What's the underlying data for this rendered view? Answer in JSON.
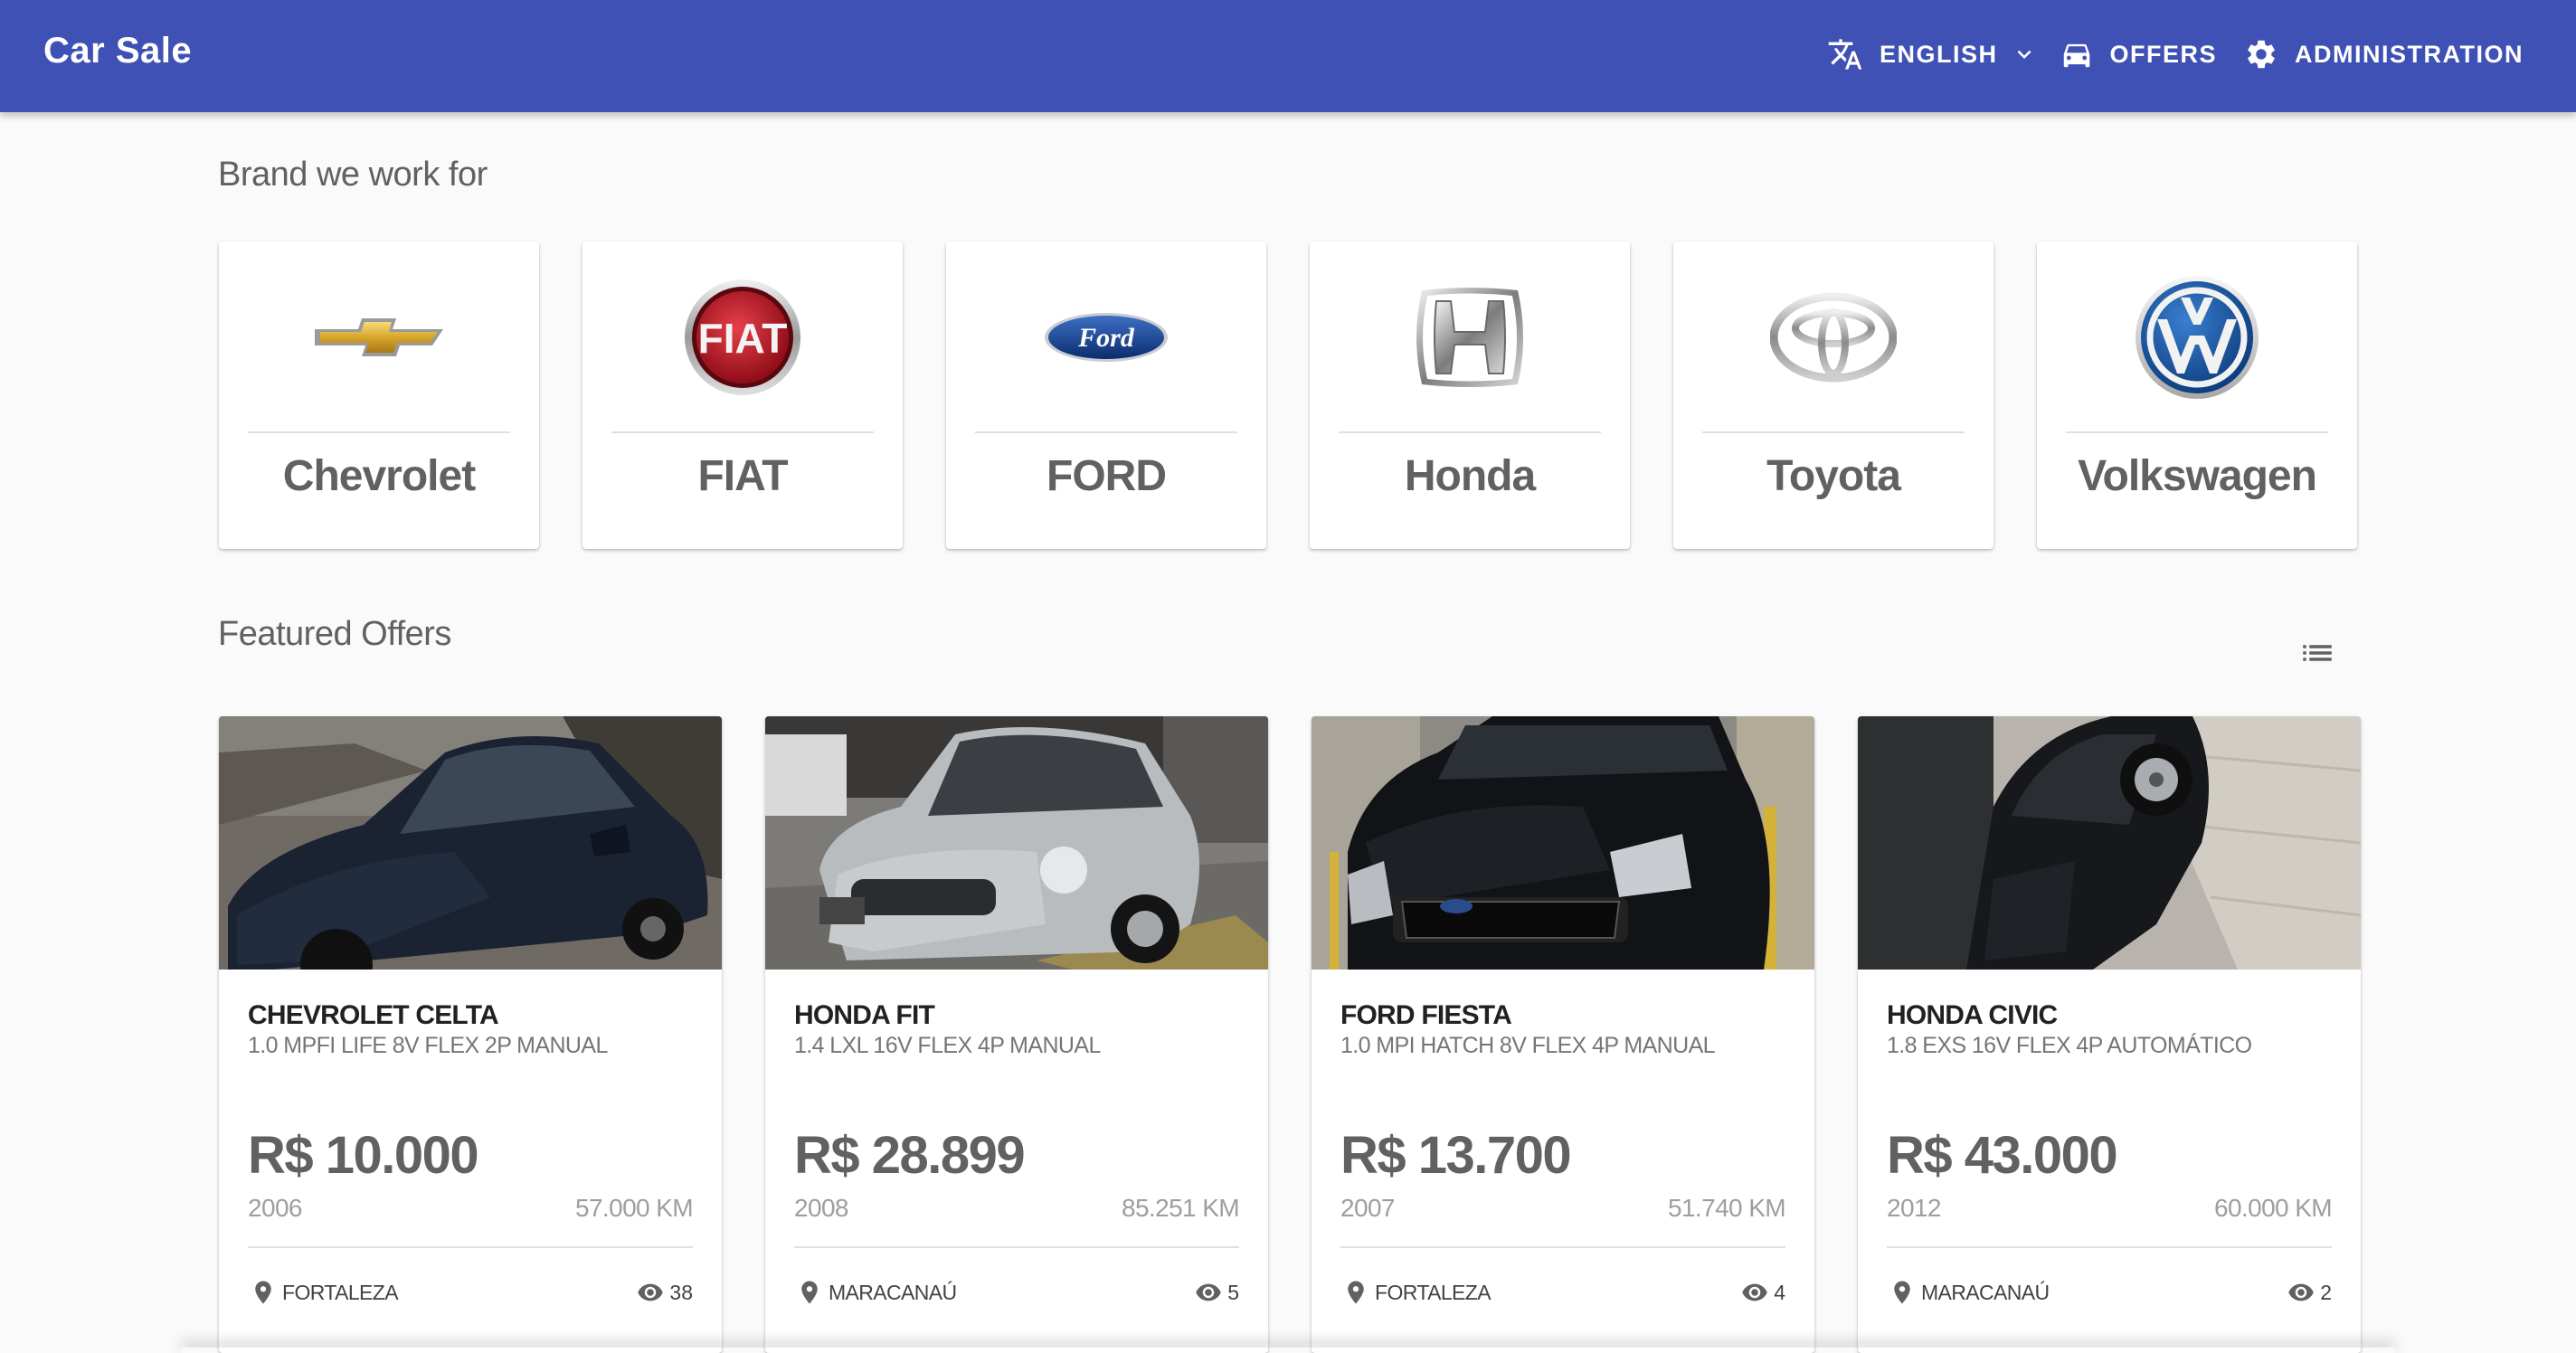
{
  "app": {
    "title": "Car Sale"
  },
  "nav": {
    "language_label": "ENGLISH",
    "offers_label": "OFFERS",
    "administration_label": "ADMINISTRATION"
  },
  "brands_section": {
    "title": "Brand we work for",
    "brands": [
      {
        "name": "Chevrolet",
        "logo_icon": "chevrolet-bowtie-logo"
      },
      {
        "name": "FIAT",
        "logo_icon": "fiat-logo"
      },
      {
        "name": "FORD",
        "logo_icon": "ford-oval-logo"
      },
      {
        "name": "Honda",
        "logo_icon": "honda-h-logo"
      },
      {
        "name": "Toyota",
        "logo_icon": "toyota-logo"
      },
      {
        "name": "Volkswagen",
        "logo_icon": "volkswagen-logo"
      }
    ]
  },
  "featured_section": {
    "title": "Featured Offers",
    "offers": [
      {
        "title": "CHEVROLET CELTA",
        "subtitle": "1.0 MPFI LIFE 8V FLEX 2P MANUAL",
        "price": "R$ 10.000",
        "year": "2006",
        "km": "57.000 KM",
        "location": "FORTALEZA",
        "views": "38"
      },
      {
        "title": "HONDA FIT",
        "subtitle": "1.4 LXL 16V FLEX 4P MANUAL",
        "price": "R$ 28.899",
        "year": "2008",
        "km": "85.251 KM",
        "location": "MARACANAÚ",
        "views": "5"
      },
      {
        "title": "FORD FIESTA",
        "subtitle": "1.0 MPI HATCH 8V FLEX 4P MANUAL",
        "price": "R$ 13.700",
        "year": "2007",
        "km": "51.740 KM",
        "location": "FORTALEZA",
        "views": "4"
      },
      {
        "title": "HONDA CIVIC",
        "subtitle": "1.8 EXS 16V FLEX 4P AUTOMÁTICO",
        "price": "R$ 43.000",
        "year": "2012",
        "km": "60.000 KM",
        "location": "MARACANAÚ",
        "views": "2"
      }
    ]
  },
  "colors": {
    "primary": "#3f51b5",
    "background": "#fafafa",
    "card": "#ffffff"
  }
}
